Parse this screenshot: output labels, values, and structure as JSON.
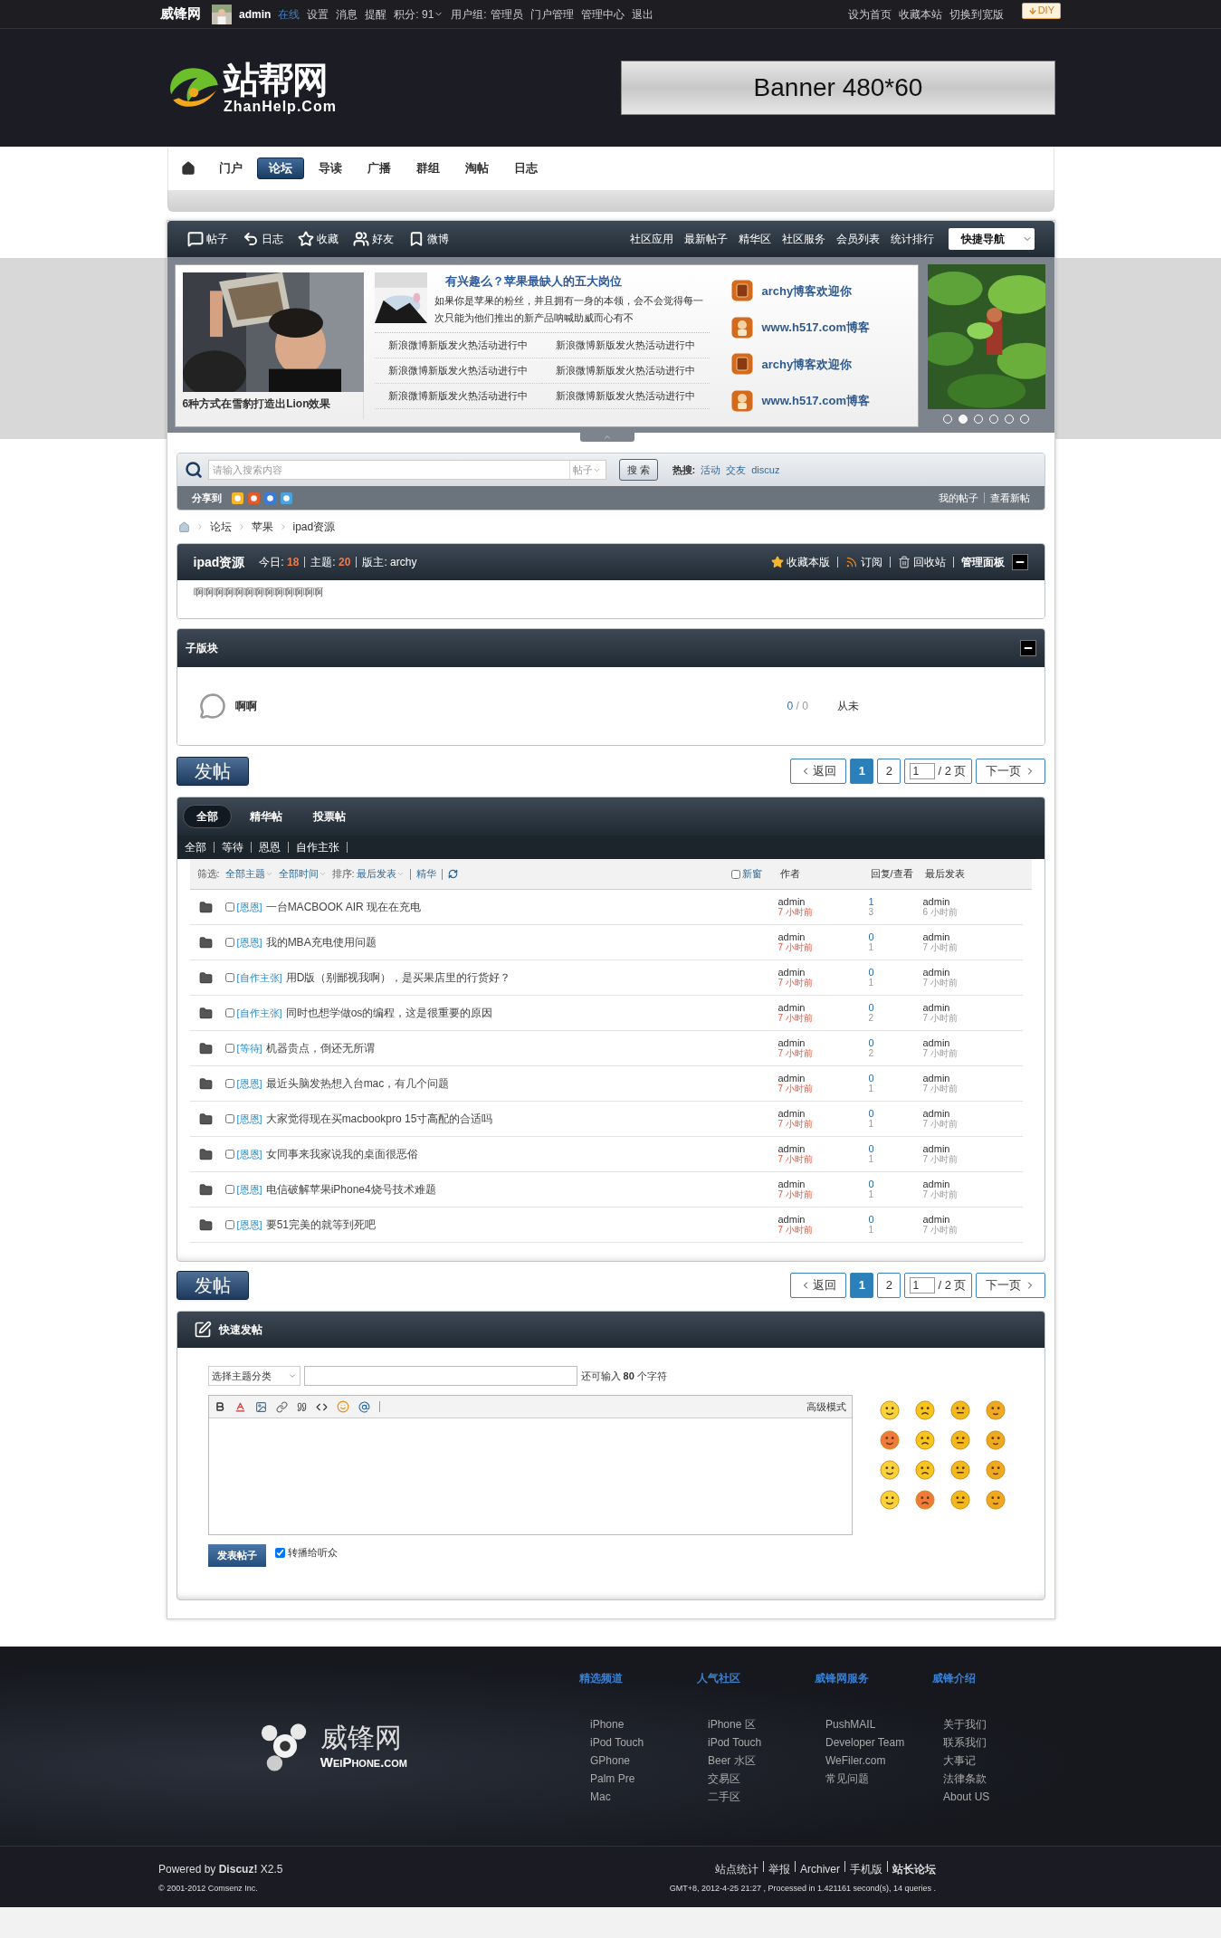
{
  "topbar": {
    "site": "威锋网",
    "user": "admin",
    "status": "在线",
    "links": [
      "设置",
      "消息",
      "提醒"
    ],
    "points": "积分: 91",
    "group_label": "用户组:",
    "group": "管理员",
    "admin_links": [
      "门户管理",
      "管理中心",
      "退出"
    ],
    "right_links": [
      "设为首页",
      "收藏本站",
      "切换到宽版"
    ],
    "diy": "DIY"
  },
  "header": {
    "logo_cn": "站帮网",
    "logo_en": "ZhanHelp.Com",
    "banner": "Banner 480*60"
  },
  "nav": [
    {
      "label": "门户",
      "selected": false
    },
    {
      "label": "论坛",
      "selected": true
    },
    {
      "label": "导读",
      "selected": false
    },
    {
      "label": "广播",
      "selected": false
    },
    {
      "label": "群组",
      "selected": false
    },
    {
      "label": "淘帖",
      "selected": false
    },
    {
      "label": "日志",
      "selected": false
    }
  ],
  "forum_bar": {
    "left": [
      {
        "label": "帖子",
        "kind": "posts"
      },
      {
        "label": "日志",
        "kind": "blog"
      },
      {
        "label": "收藏",
        "kind": "favorite"
      },
      {
        "label": "好友",
        "kind": "friends"
      },
      {
        "label": "微博",
        "kind": "weibo"
      }
    ],
    "right": [
      "社区应用",
      "最新帖子",
      "精华区",
      "社区服务",
      "会员列表",
      "统计排行"
    ],
    "quick_nav": "快捷导航"
  },
  "slides": {
    "photo_caption": "6种方式在雪豹打造出Lion效果",
    "headline": "有兴趣么？苹果最缺人的五大岗位",
    "summary": "如果你是苹果的粉丝，并且拥有一身的本领，会不会觉得每一次只能为他们推出的新产品呐喊助威而心有不",
    "news": [
      "新浪微博新版发火热活动进行中",
      "新浪微博新版发火热活动进行中",
      "新浪微博新版发火热活动进行中",
      "新浪微博新版发火热活动进行中",
      "新浪微博新版发火热活动进行中",
      "新浪微博新版发火热活动进行中"
    ],
    "blogs": [
      {
        "label": "archy博客欢迎你",
        "kind": "letter"
      },
      {
        "label": "www.h517.com博客",
        "kind": "figure"
      },
      {
        "label": "archy博客欢迎你",
        "kind": "letter"
      },
      {
        "label": "www.h517.com博客",
        "kind": "figure"
      }
    ],
    "dots": [
      {
        "selected": false
      },
      {
        "selected": true
      },
      {
        "selected": false
      },
      {
        "selected": false
      },
      {
        "selected": false
      },
      {
        "selected": false
      }
    ]
  },
  "search": {
    "placeholder": "请输入搜索内容",
    "type": "帖子",
    "button": "搜 索",
    "hot_label": "热搜:",
    "hot": [
      "活动",
      "交友",
      "discuz"
    ],
    "share_label": "分享到",
    "right_links": [
      "我的帖子",
      "查看新帖"
    ]
  },
  "breadcrumb": [
    "论坛",
    "苹果",
    "ipad资源"
  ],
  "forum": {
    "name": "ipad资源",
    "today_label": "今日:",
    "today": "18",
    "topics_label": "主题:",
    "topics": "20",
    "moderator": "版主: archy",
    "actions": [
      "收藏本版",
      "订阅",
      "回收站"
    ],
    "panel": "管理面板",
    "description": "啊啊啊啊啊啊啊啊啊啊啊啊啊"
  },
  "subforums": {
    "title": "子版块",
    "items": [
      {
        "name": "啊啊",
        "threads": "0",
        "posts": "/ 0",
        "last": "从未"
      }
    ]
  },
  "toolbar_top": {
    "post": "发帖",
    "back": "返回",
    "pages": [
      {
        "label": "1",
        "selected": true
      },
      {
        "label": "2",
        "selected": false
      }
    ],
    "page_input": "1",
    "total": "/ 2 页",
    "next": "下一页"
  },
  "threadlist": {
    "tabs": [
      {
        "label": "全部",
        "selected": true
      },
      {
        "label": "精华帖",
        "selected": false
      },
      {
        "label": "投票帖",
        "selected": false
      }
    ],
    "types": [
      "全部",
      "等待",
      "恩恩",
      "自作主张"
    ],
    "filter_label": "筛选:",
    "filters": [
      "全部主题",
      "全部时间"
    ],
    "sort_label": "排序:",
    "sort": "最后发表",
    "digest": "精华",
    "new_window": {
      "label": "新窗",
      "checked": false
    },
    "columns": [
      "作者",
      "回复/查看",
      "最后发表"
    ],
    "rows": [
      {
        "type": "[恩恩]",
        "title": "一台MACBOOK AIR 现在在充电",
        "author": "admin",
        "time": "7 小时前",
        "replies": "1",
        "views": "3",
        "last_user": "admin",
        "last_time": "6 小时前",
        "checked": false
      },
      {
        "type": "[恩恩]",
        "title": "我的MBA充电使用问题",
        "author": "admin",
        "time": "7 小时前",
        "replies": "0",
        "views": "1",
        "last_user": "admin",
        "last_time": "7 小时前",
        "checked": false
      },
      {
        "type": "[自作主张]",
        "title": "用D版（别鄙视我啊），是买果店里的行货好？",
        "author": "admin",
        "time": "7 小时前",
        "replies": "0",
        "views": "1",
        "last_user": "admin",
        "last_time": "7 小时前",
        "checked": false
      },
      {
        "type": "[自作主张]",
        "title": "同时也想学做os的编程，这是很重要的原因",
        "author": "admin",
        "time": "7 小时前",
        "replies": "0",
        "views": "2",
        "last_user": "admin",
        "last_time": "7 小时前",
        "checked": false
      },
      {
        "type": "[等待]",
        "title": "机器贵点，倒还无所谓",
        "author": "admin",
        "time": "7 小时前",
        "replies": "0",
        "views": "2",
        "last_user": "admin",
        "last_time": "7 小时前",
        "checked": false
      },
      {
        "type": "[恩恩]",
        "title": "最近头脑发热想入台mac，有几个问题",
        "author": "admin",
        "time": "7 小时前",
        "replies": "0",
        "views": "1",
        "last_user": "admin",
        "last_time": "7 小时前",
        "checked": false
      },
      {
        "type": "[恩恩]",
        "title": "大家觉得现在买macbookpro 15寸高配的合适吗",
        "author": "admin",
        "time": "7 小时前",
        "replies": "0",
        "views": "1",
        "last_user": "admin",
        "last_time": "7 小时前",
        "checked": false
      },
      {
        "type": "[恩恩]",
        "title": "女同事来我家说我的桌面很恶俗",
        "author": "admin",
        "time": "7 小时前",
        "replies": "0",
        "views": "1",
        "last_user": "admin",
        "last_time": "7 小时前",
        "checked": false
      },
      {
        "type": "[恩恩]",
        "title": "电信破解苹果iPhone4烧号技术难题",
        "author": "admin",
        "time": "7 小时前",
        "replies": "0",
        "views": "1",
        "last_user": "admin",
        "last_time": "7 小时前",
        "checked": false
      },
      {
        "type": "[恩恩]",
        "title": "要51完美的就等到死吧",
        "author": "admin",
        "time": "7 小时前",
        "replies": "0",
        "views": "1",
        "last_user": "admin",
        "last_time": "7 小时前",
        "checked": false
      }
    ]
  },
  "toolbar_bottom": {
    "post": "发帖",
    "back": "返回",
    "pages": [
      {
        "label": "1",
        "selected": true
      },
      {
        "label": "2",
        "selected": false
      }
    ],
    "page_input": "1",
    "total": "/ 2 页",
    "next": "下一页"
  },
  "quick_post": {
    "title": "快速发帖",
    "category": "选择主题分类",
    "counter": "还可输入 **80** 个字符",
    "advanced": "高级模式",
    "submit": "发表帖子",
    "broadcast": {
      "label": "转播给听众",
      "checked": true
    }
  },
  "footer": {
    "logo_cn": "威锋网",
    "logo_en": "WeiPhone.com",
    "columns": [
      {
        "title": "精选频道",
        "links": [
          "iPhone",
          "iPod Touch",
          "GPhone",
          "Palm Pre",
          "Mac"
        ]
      },
      {
        "title": "人气社区",
        "links": [
          "iPhone 区",
          "iPod Touch",
          "Beer 水区",
          "交易区",
          "二手区"
        ]
      },
      {
        "title": "威锋网服务",
        "links": [
          "PushMAIL",
          "Developer Team",
          "WeFiler.com",
          "常见问题"
        ]
      },
      {
        "title": "威锋介绍",
        "links": [
          "关于我们",
          "联系我们",
          "大事记",
          "法律条款",
          "About US"
        ]
      }
    ],
    "powered": "Powered by **Discuz!** X2.5",
    "copyright": "© 2001-2012 Comsenz Inc.",
    "links": [
      "站点统计",
      "举报",
      "Archiver",
      "手机版",
      "站长论坛"
    ],
    "info": "GMT+8, 2012-4-25 21:27 , Processed in 1.421161 second(s), 14 queries ."
  }
}
